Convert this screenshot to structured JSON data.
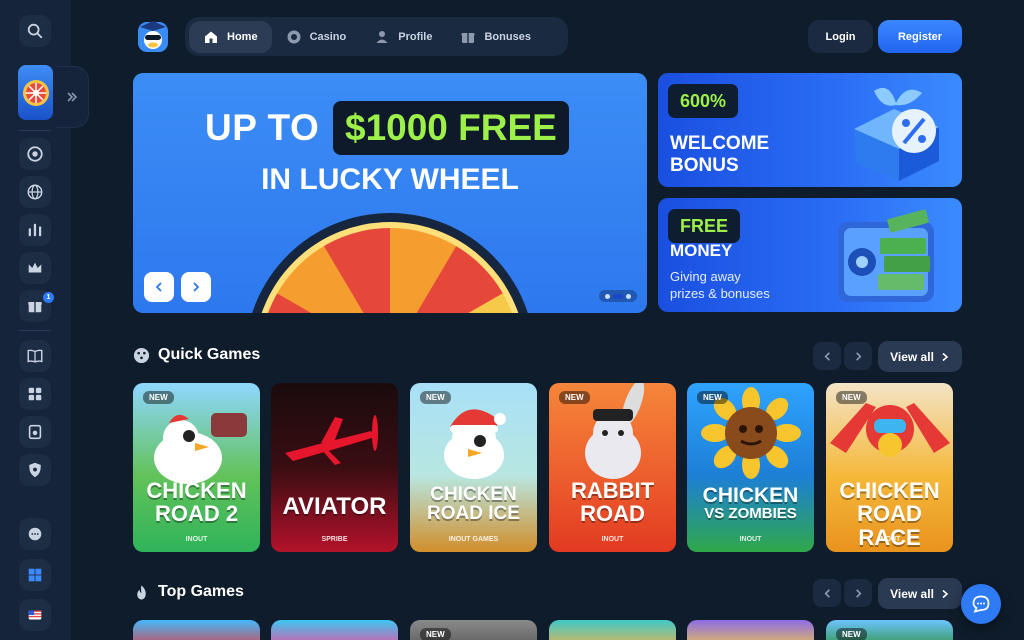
{
  "header": {
    "nav": [
      {
        "label": "Home",
        "icon": "home-icon",
        "active": true
      },
      {
        "label": "Casino",
        "icon": "chip-icon",
        "active": false
      },
      {
        "label": "Profile",
        "icon": "user-icon",
        "active": false
      },
      {
        "label": "Bonuses",
        "icon": "gift-icon",
        "active": false
      }
    ],
    "login_label": "Login",
    "register_label": "Register"
  },
  "sidebar": {
    "badge_count": "1",
    "icons": [
      "search-icon",
      "lucky-wheel-thumbnail",
      "chip-icon",
      "globe-icon",
      "signal-icon",
      "crown-icon",
      "gift-icon",
      "book-icon",
      "puzzle-icon",
      "vault-icon",
      "shield-icon",
      "support-chat-icon",
      "windows-icon",
      "us-flag-icon"
    ]
  },
  "hero": {
    "line1": "UP TO",
    "highlight": "$1000 FREE",
    "line2": "IN LUCKY WHEEL",
    "active_slide": 1,
    "slide_count": 3
  },
  "promos": [
    {
      "pill": "600%",
      "title_1": "WELCOME",
      "title_2": "BONUS"
    },
    {
      "pill": "FREE",
      "title_1": "MONEY",
      "sub_1": "Giving away",
      "sub_2": "prizes & bonuses"
    }
  ],
  "quick_games": {
    "title": "Quick Games",
    "view_all": "View all",
    "games": [
      {
        "new": "NEW",
        "title_1": "CHICKEN",
        "title_2": "ROAD 2",
        "provider": "INOUT"
      },
      {
        "new": "",
        "title_1": "AVIATOR",
        "title_2": "",
        "provider": "SPRIBE"
      },
      {
        "new": "NEW",
        "title_1": "CHICKEN",
        "title_2": "ROAD ICE",
        "provider": "INOUT GAMES"
      },
      {
        "new": "NEW",
        "title_1": "RABBIT",
        "title_2": "ROAD",
        "provider": "INOUT"
      },
      {
        "new": "NEW",
        "title_1": "CHICKEN",
        "title_2": "VS ZOMBIES",
        "provider": "INOUT"
      },
      {
        "new": "NEW",
        "title_1": "CHICKEN",
        "title_2": "ROAD RACE",
        "provider": "INOUT"
      }
    ]
  },
  "top_games": {
    "title": "Top Games",
    "view_all": "View all",
    "new_labels": [
      "NEW",
      "NEW"
    ]
  },
  "colors": {
    "accent": "#2f7bf5",
    "highlight": "#9df04a",
    "bg": "#0f1c2b"
  }
}
